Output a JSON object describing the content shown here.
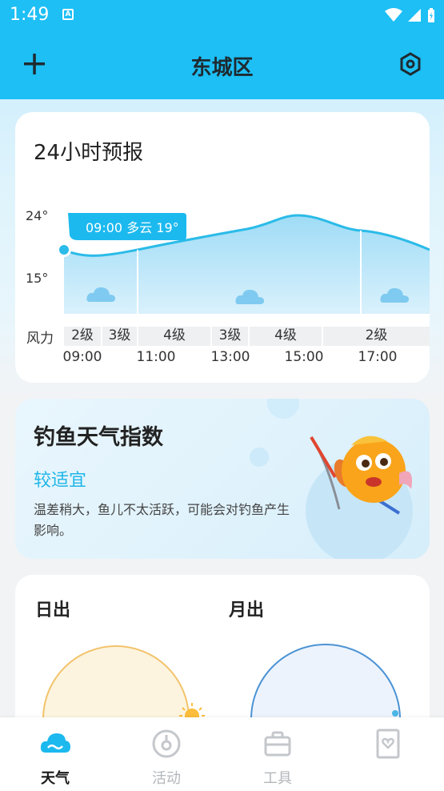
{
  "status_bar": {
    "time": "1:49",
    "notification_badge": "A"
  },
  "header": {
    "title": "东城区",
    "accent_color": "#1dbff5"
  },
  "forecast": {
    "title": "24小时预报",
    "temp_axis": [
      "24°",
      "15°"
    ],
    "tooltip": "09:00 多云 19°",
    "wind_label": "风力",
    "wind_levels": [
      "2级",
      "3级",
      "4级",
      "3级",
      "4级",
      "2级"
    ],
    "times": [
      "09:00",
      "11:00",
      "13:00",
      "15:00",
      "17:00"
    ],
    "weather_icons": [
      "cloud-icon",
      "cloud-icon",
      "cloud-icon"
    ]
  },
  "fishing": {
    "title": "钓鱼天气指数",
    "level": "较适宜",
    "description": "温差稍大，鱼儿不太活跃，可能会对钓鱼产生影响。"
  },
  "sun_moon": {
    "sunrise_title": "日出",
    "moonrise_title": "月出"
  },
  "tabs": [
    {
      "label": "天气",
      "icon": "weather-icon",
      "active": true
    },
    {
      "label": "活动",
      "icon": "compass-icon",
      "active": false
    },
    {
      "label": "工具",
      "icon": "toolbox-icon",
      "active": false
    },
    {
      "label": "",
      "icon": "heart-card-icon",
      "active": false
    }
  ]
}
